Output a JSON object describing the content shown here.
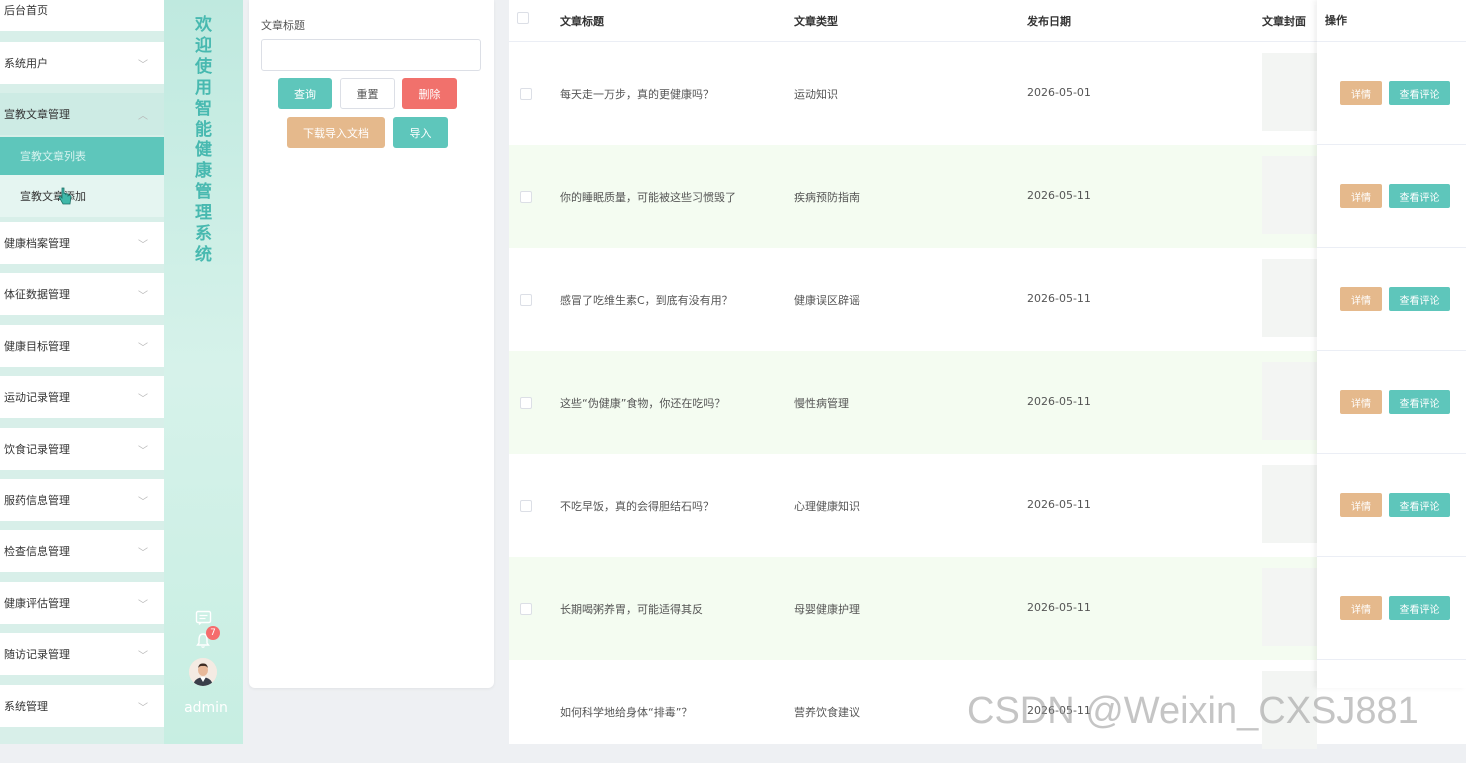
{
  "menu": {
    "items": [
      {
        "label": "后台首页",
        "chevron": false
      },
      {
        "label": "系统用户",
        "chevron": true
      },
      {
        "label": "宣教文章管理",
        "chevron": true,
        "open": true
      },
      {
        "label": "健康档案管理",
        "chevron": true
      },
      {
        "label": "体征数据管理",
        "chevron": true
      },
      {
        "label": "健康目标管理",
        "chevron": true
      },
      {
        "label": "运动记录管理",
        "chevron": true
      },
      {
        "label": "饮食记录管理",
        "chevron": true
      },
      {
        "label": "服药信息管理",
        "chevron": true
      },
      {
        "label": "检查信息管理",
        "chevron": true
      },
      {
        "label": "健康评估管理",
        "chevron": true
      },
      {
        "label": "随访记录管理",
        "chevron": true
      },
      {
        "label": "系统管理",
        "chevron": true
      }
    ],
    "submenu": {
      "active": "宣教文章列表",
      "other": "宣教文章添加"
    }
  },
  "strip": {
    "welcome_chars": [
      "欢",
      "迎",
      "使",
      "用",
      "智",
      "能",
      "健",
      "康",
      "管",
      "理",
      "系",
      "统"
    ],
    "badge": "7",
    "user": "admin"
  },
  "search": {
    "label": "文章标题",
    "value": "",
    "buttons": {
      "query": "查询",
      "reset": "重置",
      "delete": "删除",
      "download": "下载导入文档",
      "import": "导入"
    }
  },
  "table": {
    "headers": {
      "title": "文章标题",
      "type": "文章类型",
      "date": "发布日期",
      "cover": "文章封面",
      "ops": "操作"
    },
    "rows": [
      {
        "title": "每天走一万步，真的更健康吗？",
        "type": "运动知识",
        "date": "2026-05-01"
      },
      {
        "title": "你的睡眠质量，可能被这些习惯毁了",
        "type": "疾病预防指南",
        "date": "2026-05-11"
      },
      {
        "title": "感冒了吃维生素C，到底有没有用？",
        "type": "健康误区辟谣",
        "date": "2026-05-11"
      },
      {
        "title": "这些“伪健康”食物，你还在吃吗？",
        "type": "慢性病管理",
        "date": "2026-05-11"
      },
      {
        "title": "不吃早饭，真的会得胆结石吗？",
        "type": "心理健康知识",
        "date": "2026-05-11"
      },
      {
        "title": "长期喝粥养胃，可能适得其反",
        "type": "母婴健康护理",
        "date": "2026-05-11"
      },
      {
        "title": "如何科学地给身体“排毒”？",
        "type": "营养饮食建议",
        "date": "2026-05-11"
      }
    ],
    "row_buttons": {
      "detail": "详情",
      "comments": "查看评论"
    }
  },
  "colors": {
    "accent": "#5ec6bb",
    "danger": "#f1716c",
    "tan": "#e5b98c",
    "stripe": "#f4fcf1"
  },
  "watermark": "CSDN @Weixin_CXSJ881"
}
